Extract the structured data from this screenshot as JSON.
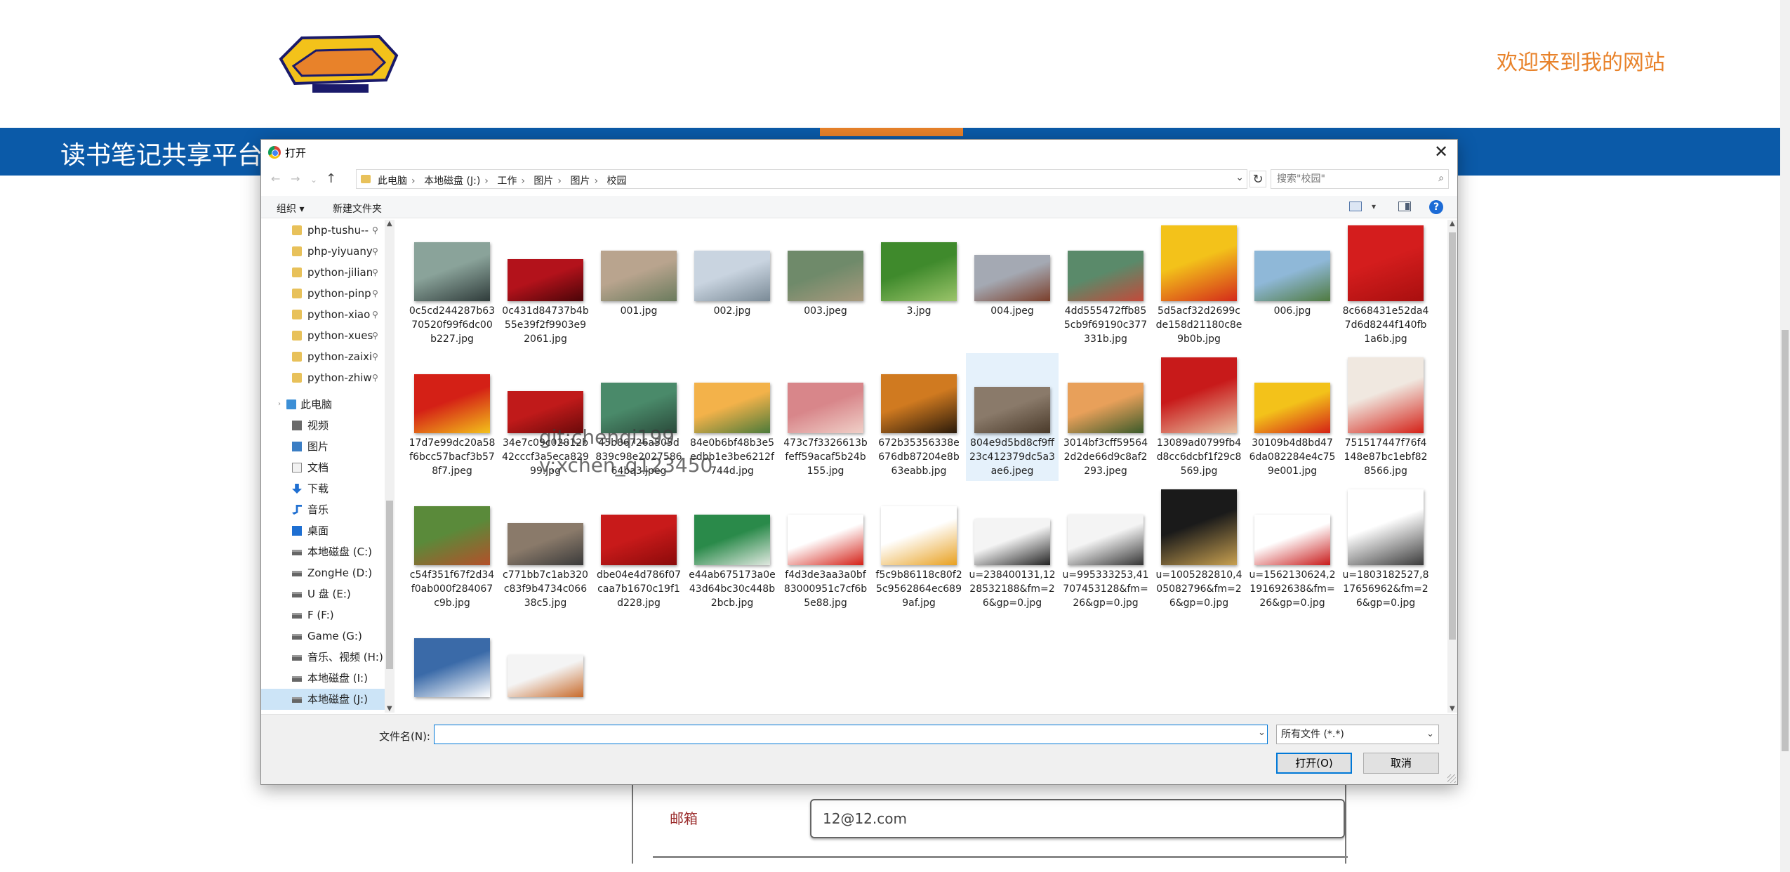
{
  "site": {
    "welcome": "欢迎来到我的网站",
    "title": "读书笔记共享平台",
    "form": {
      "email_label": "邮箱",
      "email_value": "12@12.com"
    },
    "colors": {
      "nav_blue": "#0b5aa8",
      "accent_orange": "#e8822a"
    }
  },
  "dialog": {
    "title": "打开",
    "close": "✕",
    "breadcrumb": [
      "此电脑",
      "本地磁盘 (J:)",
      "工作",
      "图片",
      "图片",
      "校园"
    ],
    "search_placeholder": "搜索\"校园\"",
    "toolbar": {
      "organize": "组织 ▾",
      "new_folder": "新建文件夹",
      "help": "?"
    },
    "nav": [
      {
        "label": "php-tushu--",
        "icon": "folder-icon",
        "pinned": true
      },
      {
        "label": "php-yiyuany",
        "icon": "folder-icon",
        "pinned": true
      },
      {
        "label": "python-jilian",
        "icon": "folder-icon",
        "pinned": true
      },
      {
        "label": "python-pinp",
        "icon": "folder-icon",
        "pinned": true
      },
      {
        "label": "python-xiao",
        "icon": "folder-icon",
        "pinned": true
      },
      {
        "label": "python-xues",
        "icon": "folder-icon",
        "pinned": true
      },
      {
        "label": "python-zaixi",
        "icon": "folder-icon",
        "pinned": true
      },
      {
        "label": "python-zhiw",
        "icon": "folder-icon",
        "pinned": true
      },
      {
        "label": "此电脑",
        "icon": "pc-icon",
        "pc": true
      },
      {
        "label": "视频",
        "icon": "video-icon"
      },
      {
        "label": "图片",
        "icon": "pictures-icon"
      },
      {
        "label": "文档",
        "icon": "documents-icon"
      },
      {
        "label": "下载",
        "icon": "download-icon"
      },
      {
        "label": "音乐",
        "icon": "music-icon"
      },
      {
        "label": "桌面",
        "icon": "desktop-icon"
      },
      {
        "label": "本地磁盘 (C:)",
        "icon": "drive-icon"
      },
      {
        "label": "ZongHe (D:)",
        "icon": "drive-icon"
      },
      {
        "label": "U 盘 (E:)",
        "icon": "drive-icon"
      },
      {
        "label": "F (F:)",
        "icon": "drive-icon"
      },
      {
        "label": "Game (G:)",
        "icon": "drive-icon"
      },
      {
        "label": "音乐、视频 (H:)",
        "icon": "drive-icon"
      },
      {
        "label": "本地磁盘 (I:)",
        "icon": "drive-icon"
      },
      {
        "label": "本地磁盘 (J:)",
        "icon": "drive-icon",
        "selected": true
      }
    ],
    "files": [
      {
        "name": "0c5cd244287b6370520f99f6dc00b227.jpg",
        "colors": [
          "#8aa39a",
          "#2f3b3a"
        ]
      },
      {
        "name": "0c431d84737b4b55e39f2f9903e92061.jpg",
        "colors": [
          "#b3121b",
          "#4a0508"
        ]
      },
      {
        "name": "001.jpg",
        "colors": [
          "#b9a48e",
          "#6a7b5d"
        ]
      },
      {
        "name": "002.jpg",
        "colors": [
          "#c9d4e0",
          "#7a8a96"
        ]
      },
      {
        "name": "003.jpeg",
        "colors": [
          "#6f8a6a",
          "#a99a7e"
        ]
      },
      {
        "name": "3.jpg",
        "colors": [
          "#3f8a2c",
          "#9bc46a"
        ]
      },
      {
        "name": "004.jpeg",
        "colors": [
          "#a4a9b3",
          "#7b3e2a"
        ]
      },
      {
        "name": "4dd555472ffb855cb9f69190c377331b.jpg",
        "colors": [
          "#5a8a6a",
          "#c44a3a"
        ]
      },
      {
        "name": "5d5acf32d2699cde158d21180c8e9b0b.jpg",
        "colors": [
          "#f3c21a",
          "#d42a1a"
        ]
      },
      {
        "name": "006.jpg",
        "colors": [
          "#8fb8d8",
          "#4f7a3f"
        ]
      },
      {
        "name": "8c668431e52da47d6d8244f140fb1a6b.jpg",
        "colors": [
          "#d41d1d",
          "#a80f0f"
        ]
      },
      {
        "name": "17d7e99dc20a58f6bcc57bacf3b578f7.jpeg",
        "colors": [
          "#d42016",
          "#f3c21a"
        ]
      },
      {
        "name": "34e7c09c02812b42cccf3a5eca82999.jpg",
        "colors": [
          "#c01a1a",
          "#6a0a0a"
        ]
      },
      {
        "name": "45b86726a505d839c98e202758664ba3.jpeg",
        "colors": [
          "#4a8a6a",
          "#2a4a3a"
        ]
      },
      {
        "name": "84e0b6bf48b3e5edbb1e3be6212f744d.jpg",
        "colors": [
          "#f3b24a",
          "#4a7a3a"
        ]
      },
      {
        "name": "473c7f3326613bfeff59acaf5b24b155.jpg",
        "colors": [
          "#d8868a",
          "#f0d0c8"
        ]
      },
      {
        "name": "672b35356338e676db87204e8b63eabb.jpg",
        "colors": [
          "#d07a20",
          "#2a1a0a"
        ]
      },
      {
        "name": "804e9d5bd8cf9ff23c412379dc5a3ae6.jpeg",
        "colors": [
          "#8a7a6a",
          "#4a3a2a"
        ],
        "selected": true
      },
      {
        "name": "3014bf3cff595642d2de66d9c8af2293.jpeg",
        "colors": [
          "#e8a05a",
          "#3a5a2a"
        ]
      },
      {
        "name": "13089ad0799fb4d8cc6dcbf1f29c8569.jpg",
        "colors": [
          "#c81a1a",
          "#e8c0a0"
        ]
      },
      {
        "name": "30109b4d8bd476da082284e4c759e001.jpg",
        "colors": [
          "#f3c21a",
          "#d42016"
        ]
      },
      {
        "name": "751517447f76f4148e87bc1ebf828566.jpg",
        "colors": [
          "#f0e8e0",
          "#d42016"
        ]
      },
      {
        "name": "c54f351f67f2d34f0ab000f284067c9b.jpg",
        "colors": [
          "#5a8a3a",
          "#b4502a"
        ]
      },
      {
        "name": "c771bb7c1ab320c83f9b4734c06638c5.jpg",
        "colors": [
          "#8a7a6a",
          "#3a3a3a"
        ]
      },
      {
        "name": "dbe04e4d786f07caa7b1670c19f1d228.jpg",
        "colors": [
          "#c81a1a",
          "#8a0a0a"
        ]
      },
      {
        "name": "e44ab675173a0e43d64bc30c448b2bcb.jpg",
        "colors": [
          "#2a8a4a",
          "#e0e8e0"
        ]
      },
      {
        "name": "f4d3de3aa3a0bf83000951c7cf6b5e88.jpg",
        "colors": [
          "#ffffff",
          "#d42016"
        ]
      },
      {
        "name": "f5c9b86118c80f25c9562864ec6899af.jpg",
        "colors": [
          "#ffffff",
          "#e8a020"
        ]
      },
      {
        "name": "u=238400131,1228532188&fm=26&gp=0.jpg",
        "colors": [
          "#f4f4f4",
          "#222222"
        ]
      },
      {
        "name": "u=995333253,41707453128&fm=26&gp=0.jpg",
        "colors": [
          "#f4f4f4",
          "#333333"
        ]
      },
      {
        "name": "u=1005282810,405082796&fm=26&gp=0.jpg",
        "colors": [
          "#1a1a1a",
          "#c8a050"
        ]
      },
      {
        "name": "u=1562130624,2191692638&fm=26&gp=0.jpg",
        "colors": [
          "#ffffff",
          "#c81a1a"
        ]
      },
      {
        "name": "u=1803182527,817656962&fm=26&gp=0.jpg",
        "colors": [
          "#ffffff",
          "#3a3a3a"
        ]
      },
      {
        "name": "",
        "colors": [
          "#3a6aa8",
          "#ffffff"
        ]
      },
      {
        "name": "",
        "colors": [
          "#f4f4f4",
          "#c86a2a"
        ]
      }
    ],
    "watermark_line1": "git:chenqi199",
    "watermark_line2": "v:xchen_q123450",
    "filename_label": "文件名(N):",
    "filename_value": "",
    "file_type": "所有文件 (*.*)",
    "open_button": "打开(O)",
    "cancel_button": "取消"
  }
}
